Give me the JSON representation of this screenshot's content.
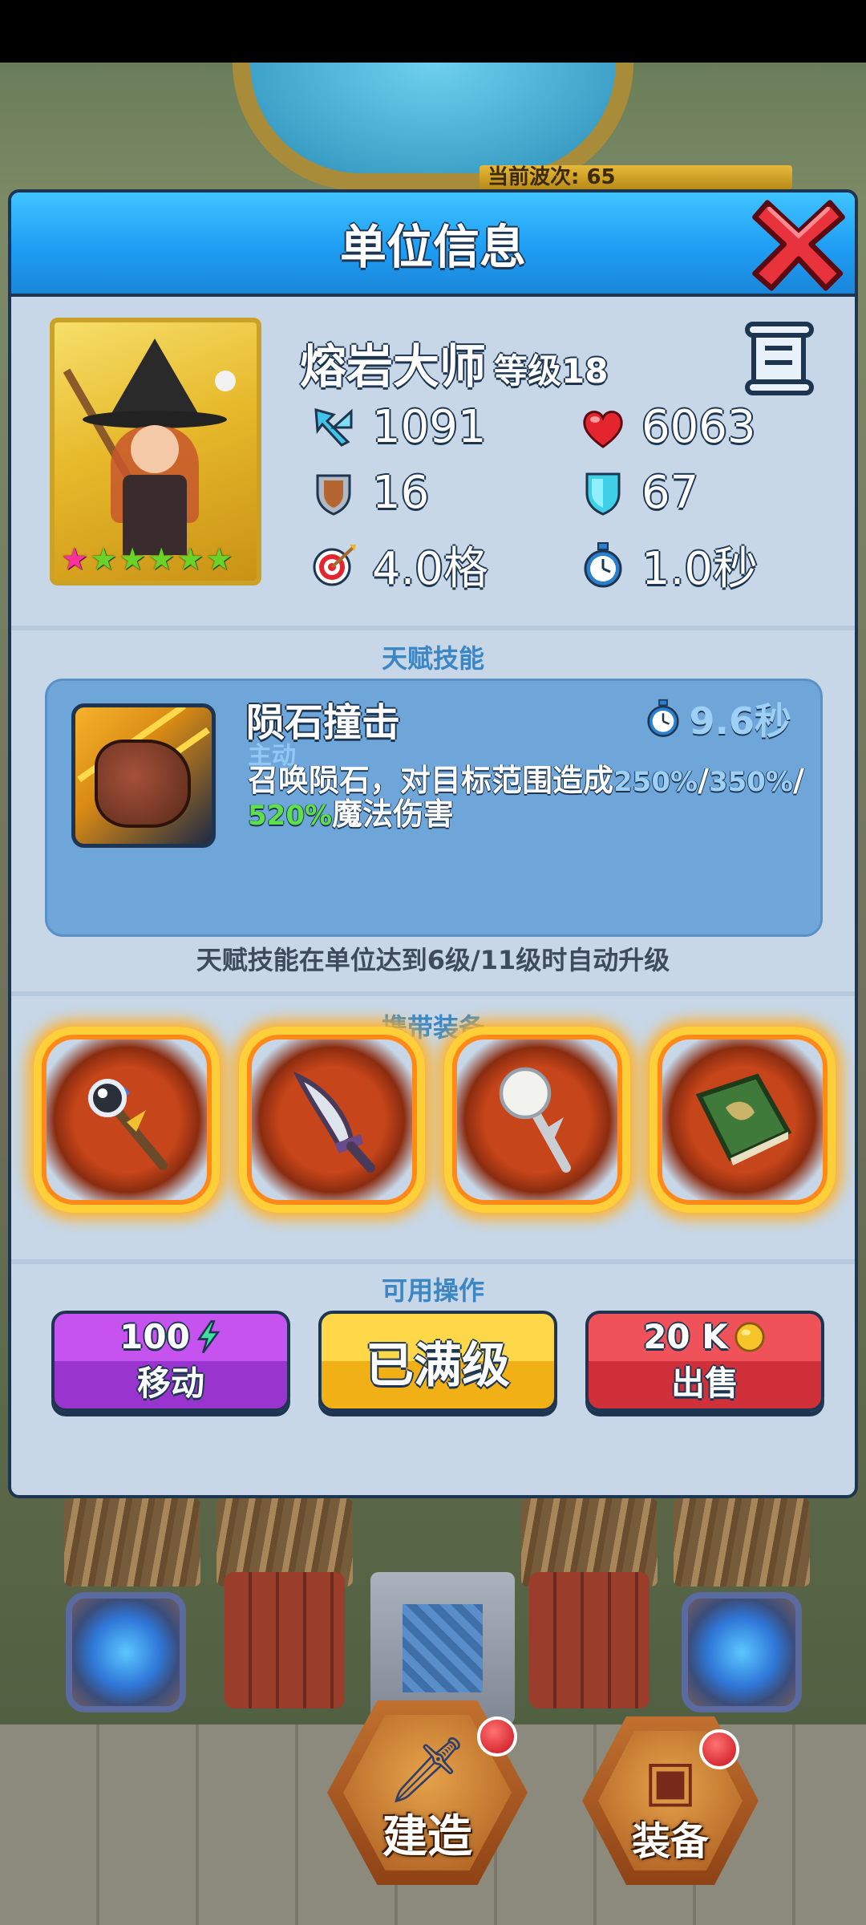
{
  "background": {
    "wave_label": "当前波次: 65"
  },
  "modal": {
    "title": "单位信息",
    "unit": {
      "name": "熔岩大师",
      "level": "等级18",
      "stars": [
        {
          "color": "pink"
        },
        {
          "color": "green"
        },
        {
          "color": "green"
        },
        {
          "color": "green"
        },
        {
          "color": "green"
        },
        {
          "color": "green"
        }
      ],
      "stats": {
        "attack": "1091",
        "health": "6063",
        "armor": "16",
        "magic_resist": "67",
        "range": "4.0格",
        "attack_speed": "1.0秒"
      }
    },
    "talent_section_title": "天赋技能",
    "skill": {
      "name": "陨石撞击",
      "type": "主动",
      "cooldown": "9.6秒",
      "desc_prefix": "召唤陨石，对目标范围造成",
      "pct_1": "250%",
      "sep_1": "/",
      "pct_2": "350%",
      "sep_2": "/",
      "pct_3": "520%",
      "desc_suffix": "魔法伤害"
    },
    "talent_note": "天赋技能在单位达到6级/11级时自动升级",
    "equipment_section_title": "携带装备",
    "equipment": [
      {
        "icon": "orb-staff-icon"
      },
      {
        "icon": "curved-dagger-icon"
      },
      {
        "icon": "white-mace-icon"
      },
      {
        "icon": "spellbook-icon"
      }
    ],
    "actions_section_title": "可用操作",
    "actions": {
      "move_cost": "100",
      "move_label": "移动",
      "max_label": "已满级",
      "sell_price": "20 K",
      "sell_label": "出售"
    }
  },
  "bottom_nav": {
    "build_label": "建造",
    "equip_label": "装备"
  }
}
